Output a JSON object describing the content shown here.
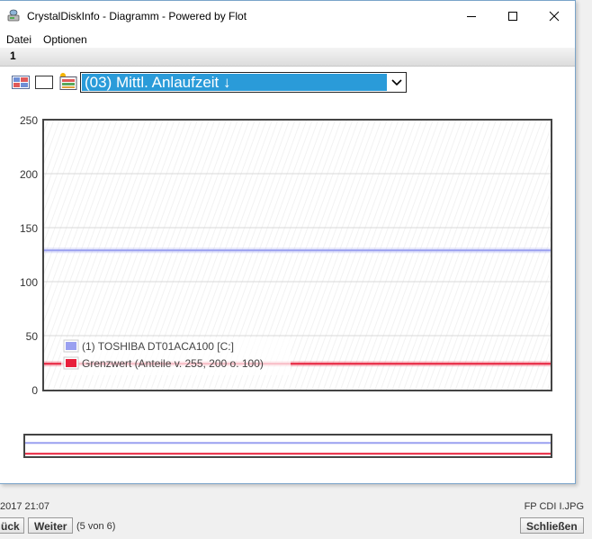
{
  "window": {
    "title": "CrystalDiskInfo - Diagramm - Powered by Flot",
    "app_icon": "disk-info-icon"
  },
  "menu": {
    "items": [
      "Datei",
      "Optionen"
    ]
  },
  "tabs": {
    "active_label": "1"
  },
  "toolbar": {
    "icons": [
      "grid-chart-icon",
      "blank-window-icon",
      "export-chart-icon"
    ],
    "attribute_select": "(03) Mittl. Anlaufzeit ↓"
  },
  "chart_data": {
    "type": "line",
    "x": [
      0,
      1
    ],
    "ylim": [
      0,
      250
    ],
    "y_ticks": [
      "250",
      "200",
      "150",
      "100",
      "50",
      "0"
    ],
    "grid": true,
    "legend_position": "bottom-left",
    "series": [
      {
        "name": "(1) TOSHIBA DT01ACA100 [C:]",
        "color": "#9aa0f0",
        "values": [
          129,
          129
        ]
      },
      {
        "name": "Grenzwert (Anteile v. 255, 200 o. 100)",
        "color": "#e8203c",
        "values": [
          24,
          24
        ]
      }
    ]
  },
  "status": {
    "left_date": "2017 21:07",
    "right_file": "FP CDI I.JPG",
    "back_label": "ück",
    "next_label": "Weiter",
    "counter": "(5 von 6)",
    "close_label": "Schließen"
  }
}
